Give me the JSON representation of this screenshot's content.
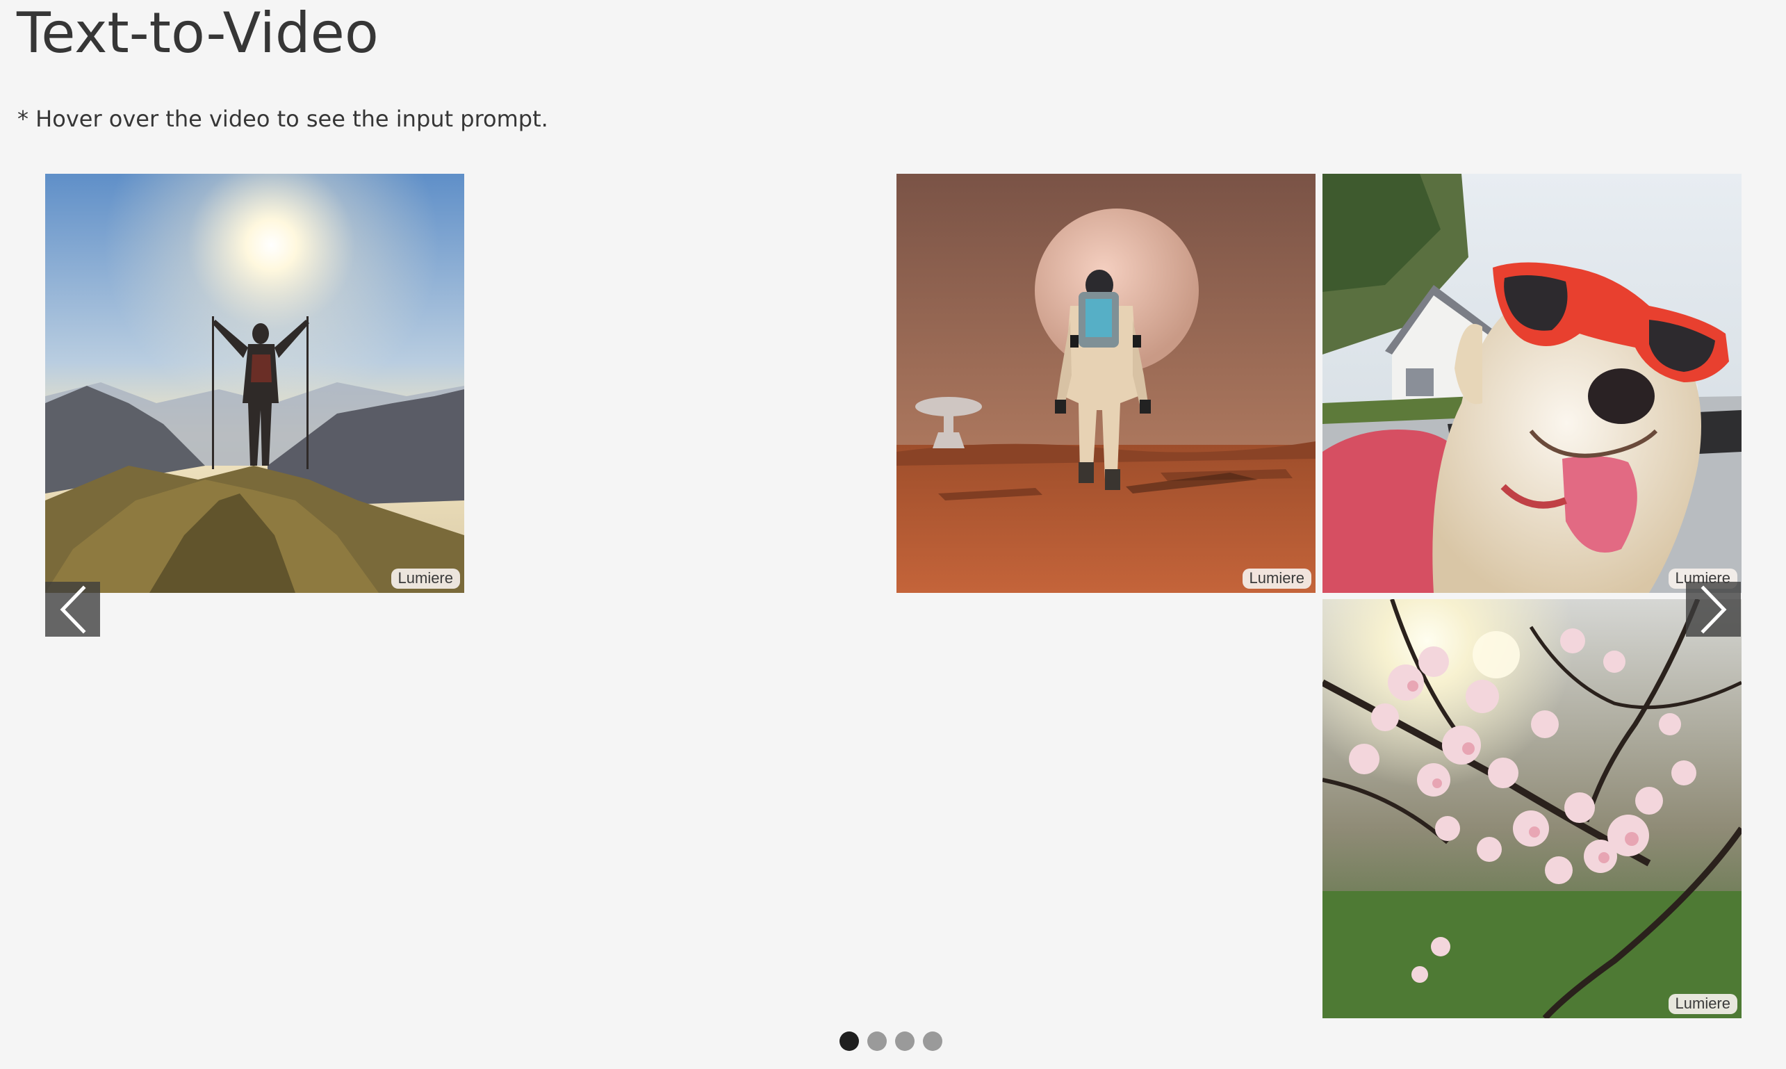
{
  "page": {
    "title": "Text-to-Video",
    "note": "* Hover over the video to see the input prompt."
  },
  "carousel": {
    "videos": [
      {
        "subject": "hiker on mountain summit at sunrise",
        "badge": "Lumiere"
      },
      {
        "subject": "astronaut walking on mars",
        "badge": "Lumiere"
      },
      {
        "subject": "dog wearing red sunglasses in car",
        "badge": "Lumiere"
      },
      {
        "subject": "cherry blossoms with sunlight",
        "badge": "Lumiere"
      }
    ],
    "prev_icon": "chevron-left-icon",
    "next_icon": "chevron-right-icon",
    "page_count": 4,
    "active_page": 1
  },
  "colors": {
    "background": "#f5f5f5",
    "text": "#363636",
    "nav_button": "#3c3c3c",
    "dot_active": "#1f1f1f",
    "dot_inactive": "#9a9a9a"
  }
}
